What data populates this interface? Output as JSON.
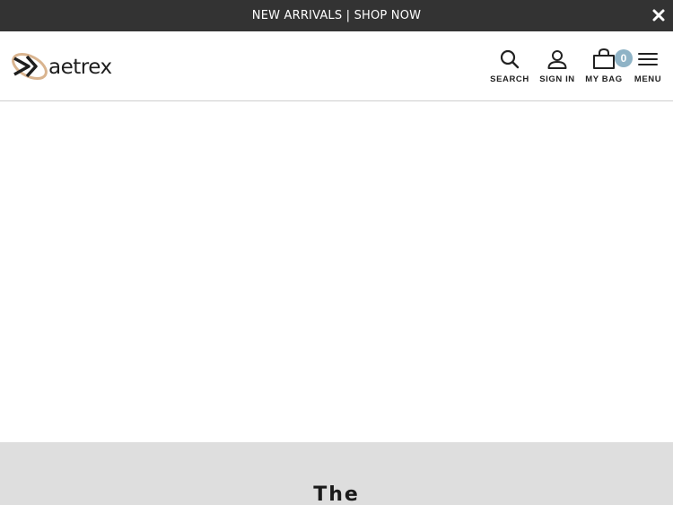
{
  "promo": {
    "text": "NEW ARRIVALS | SHOP NOW",
    "close_icon": "close-icon"
  },
  "header": {
    "logo_text": "aetrex",
    "logo_icon": "aetrex-logo-mark-icon",
    "nav": {
      "search_label": "SEARCH",
      "signin_label": "SIGN IN",
      "bag_label": "MY BAG",
      "bag_count": "0",
      "menu_label": "MENU"
    }
  },
  "section": {
    "heading": "The"
  },
  "colors": {
    "promo_bg": "#333333",
    "badge": "#8fb3c6",
    "logo_accent": "#d9b48f",
    "section_bg": "#dedede"
  }
}
